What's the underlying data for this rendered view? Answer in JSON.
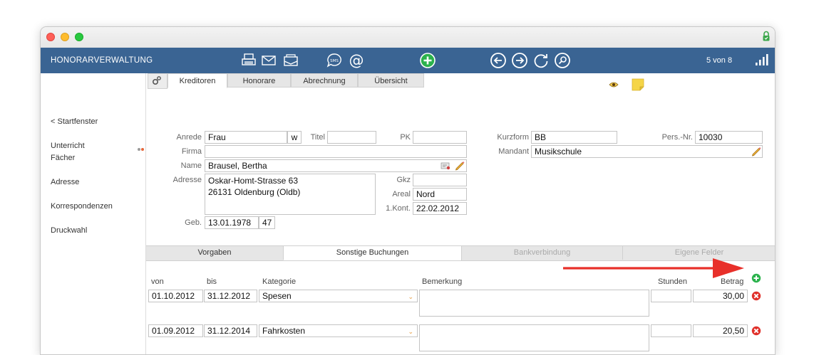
{
  "app": {
    "title": "HONORARVERWALTUNG",
    "counter": "5 von 8",
    "header_color": "#3a6493"
  },
  "header_icons": [
    "print-icon",
    "mail-icon",
    "mail-open-icon",
    "sms-icon",
    "at-icon",
    "add-icon",
    "back-icon",
    "forward-icon",
    "refresh-icon",
    "search-icon"
  ],
  "sidebar": {
    "items": [
      {
        "label": "< Startfenster"
      },
      {
        "label": "Unterricht"
      },
      {
        "label": "Fächer"
      },
      {
        "label": "Adresse"
      },
      {
        "label": "Korrespondenzen"
      },
      {
        "label": "Druckwahl"
      }
    ]
  },
  "tabs": [
    {
      "label": "Kreditoren",
      "active": true
    },
    {
      "label": "Honorare"
    },
    {
      "label": "Abrechnung"
    },
    {
      "label": "Übersicht"
    }
  ],
  "form": {
    "anrede_label": "Anrede",
    "anrede": "Frau",
    "gender": "w",
    "titel_label": "Titel",
    "titel": "",
    "pk_label": "PK",
    "pk": "",
    "firma_label": "Firma",
    "firma": "",
    "name_label": "Name",
    "name": "Brausel, Bertha",
    "adresse_label": "Adresse",
    "adresse_line1": "Oskar-Homt-Strasse 63",
    "adresse_line2": "26131 Oldenburg (Oldb)",
    "gkz_label": "Gkz",
    "gkz": "",
    "areal_label": "Areal",
    "areal": "Nord",
    "kont_label": "1.Kont.",
    "kont": "22.02.2012",
    "geb_label": "Geb.",
    "geb": "13.01.1978",
    "age": "47",
    "kurzform_label": "Kurzform",
    "kurzform": "BB",
    "persnr_label": "Pers.-Nr.",
    "persnr": "10030",
    "mandant_label": "Mandant",
    "mandant": "Musikschule"
  },
  "subtabs": [
    {
      "label": "Vorgaben"
    },
    {
      "label": "Sonstige Buchungen",
      "active": true
    },
    {
      "label": "Bankverbindung",
      "disabled": true
    },
    {
      "label": "Eigene Felder",
      "disabled": true
    }
  ],
  "bookings": {
    "columns": {
      "von": "von",
      "bis": "bis",
      "kategorie": "Kategorie",
      "bemerkung": "Bemerkung",
      "stunden": "Stunden",
      "betrag": "Betrag"
    },
    "rows": [
      {
        "von": "01.10.2012",
        "bis": "31.12.2012",
        "kategorie": "Spesen",
        "bemerkung": "",
        "stunden": "",
        "betrag": "30,00"
      },
      {
        "von": "01.09.2012",
        "bis": "31.12.2014",
        "kategorie": "Fahrkosten",
        "bemerkung": "",
        "stunden": "",
        "betrag": "20,50"
      }
    ]
  },
  "colors": {
    "accent_red": "#e8302a",
    "add_green": "#2bb24c",
    "note_yellow": "#f5d547"
  }
}
